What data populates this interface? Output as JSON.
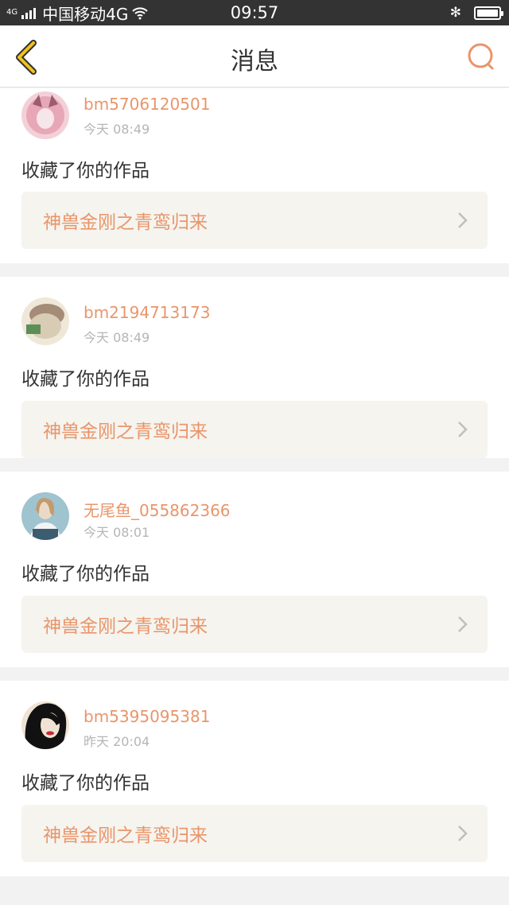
{
  "status_bar": {
    "network_label": "4G",
    "carrier": "中国移动4G",
    "time": "09:57",
    "bluetooth": "✻"
  },
  "header": {
    "title": "消息"
  },
  "messages": [
    {
      "username": "bm5706120501",
      "time": "今天 08:49",
      "action": "收藏了你的作品",
      "work_title": "神兽金刚之青鸾归来",
      "avatar_colors": [
        "#e8a7b6",
        "#9c5c6d",
        "#f3d0d8"
      ]
    },
    {
      "username": "bm2194713173",
      "time": "今天 08:49",
      "action": "收藏了你的作品",
      "work_title": "神兽金刚之青鸾归来",
      "avatar_colors": [
        "#d8cdb4",
        "#a58c78",
        "#5b8f57"
      ]
    },
    {
      "username": "无尾鱼_055862366",
      "time": "今天 08:01",
      "action": "收藏了你的作品",
      "work_title": "神兽金刚之青鸾归来",
      "avatar_colors": [
        "#9fc3cf",
        "#e9d9c8",
        "#3b5d6f"
      ]
    },
    {
      "username": "bm5395095381",
      "time": "昨天 20:04",
      "action": "收藏了你的作品",
      "work_title": "神兽金刚之青鸾归来",
      "avatar_colors": [
        "#111111",
        "#c42a35",
        "#f0e3d3"
      ]
    }
  ],
  "colors": {
    "accent": "#e9956a",
    "back_arrow": "#f2c21a",
    "card_bg": "#ffffff",
    "link_bg": "#f5f4ef"
  }
}
